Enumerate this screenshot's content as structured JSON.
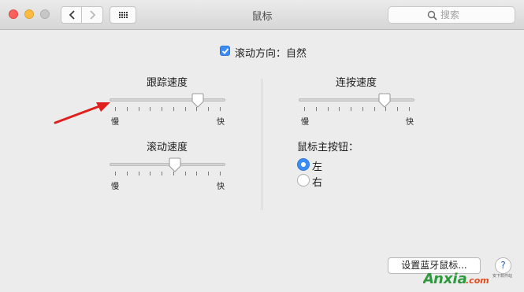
{
  "window": {
    "title": "鼠标"
  },
  "search": {
    "placeholder": "搜索"
  },
  "scroll_direction": {
    "checked": true,
    "label": "滚动方向：自然"
  },
  "tracking_speed": {
    "label": "跟踪速度",
    "value": 0.79,
    "slow": "慢",
    "fast": "快"
  },
  "scrolling_speed": {
    "label": "滚动速度",
    "value": 0.57,
    "slow": "慢",
    "fast": "快"
  },
  "double_click_speed": {
    "label": "连按速度",
    "value": 0.77,
    "slow": "慢",
    "fast": "快"
  },
  "primary_button": {
    "label": "鼠标主按钮：",
    "options": [
      "左",
      "右"
    ],
    "selected": "左"
  },
  "bluetooth_button": {
    "label": "设置蓝牙鼠标..."
  },
  "help_button": {
    "label": "?"
  },
  "watermark": {
    "brand": "Anxia.com",
    "tag": "安下软件站"
  },
  "colors": {
    "accent": "#3b8df5",
    "annotation_arrow": "#e0201c"
  }
}
